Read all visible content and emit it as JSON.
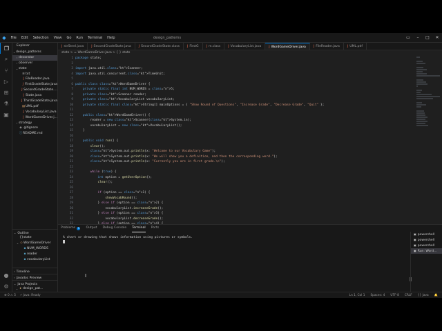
{
  "titlebar": {
    "menu": [
      "File",
      "Edit",
      "Selection",
      "View",
      "Go",
      "Run",
      "Terminal",
      "Help"
    ],
    "title": "design_patterns"
  },
  "explorer": {
    "header": "Explorer",
    "root": "design_patterns",
    "items": [
      {
        "label": "decorator",
        "kind": "folder",
        "depth": 1,
        "open": false,
        "selected": true
      },
      {
        "label": "observer",
        "kind": "folder",
        "depth": 1,
        "open": false
      },
      {
        "label": "state",
        "kind": "folder",
        "depth": 1,
        "open": true
      },
      {
        "label": "txt",
        "kind": "text",
        "depth": 2
      },
      {
        "label": "FileReader.java",
        "kind": "java",
        "depth": 2
      },
      {
        "label": "FirstGradeState.java",
        "kind": "java",
        "depth": 2
      },
      {
        "label": "SecondGradeState....",
        "kind": "java",
        "depth": 2
      },
      {
        "label": "State.java",
        "kind": "java",
        "depth": 2
      },
      {
        "label": "ThirdGradeState.java",
        "kind": "java",
        "depth": 2
      },
      {
        "label": "UML.pdf",
        "kind": "pdf",
        "depth": 2
      },
      {
        "label": "VocabularyList.java",
        "kind": "java",
        "depth": 2
      },
      {
        "label": "WordGameDriver.j...",
        "kind": "java",
        "depth": 2
      },
      {
        "label": "strategy",
        "kind": "folder",
        "depth": 1,
        "open": false
      },
      {
        "label": ".gitignore",
        "kind": "git",
        "depth": 1
      },
      {
        "label": "README.md",
        "kind": "md",
        "depth": 1
      }
    ],
    "outline_header": "Outline",
    "outline": [
      {
        "label": "state",
        "kind": "pkg",
        "depth": 1
      },
      {
        "label": "WordGameDriver",
        "kind": "class",
        "depth": 1
      },
      {
        "label": "NUM_WORDS",
        "kind": "field",
        "depth": 2
      },
      {
        "label": "reader",
        "kind": "field",
        "depth": 2
      },
      {
        "label": "vocabularyList",
        "kind": "field",
        "depth": 2
      }
    ],
    "timeline_header": "Timeline",
    "javadoc_header": "Javadoc Preview",
    "java_projects_header": "Java Projects",
    "java_projects": [
      {
        "label": "design_pat...",
        "depth": 1
      },
      {
        "label": "state",
        "depth": 2
      },
      {
        "label": "WordGa...",
        "depth": 3
      },
      {
        "label": "UML.pdf",
        "depth": 3
      },
      {
        "label": "state.txt",
        "depth": 2
      }
    ]
  },
  "tabs": [
    {
      "label": "strSteel.java",
      "active": false
    },
    {
      "label": "SecondGradeState.java",
      "active": false
    },
    {
      "label": "SecondGradeState.class",
      "active": false
    },
    {
      "label": "FirstG",
      "active": false
    },
    {
      "label": "m.class",
      "active": false
    },
    {
      "label": "VocabularyList.java",
      "active": false
    },
    {
      "label": "WordGameDriver.java",
      "active": true
    },
    {
      "label": "FileReader.java",
      "active": false
    },
    {
      "label": "UML.pdf",
      "active": false
    }
  ],
  "breadcrumb": "state > ☕ WordGameDriver.java > { } state",
  "code_lines": [
    "package state;",
    "",
    "import java.util.Scanner;",
    "import java.util.concurrent.TimeUnit;",
    "",
    "public class WordGameDriver {",
    "    private static final int NUM_WORDS = 5;",
    "    private Scanner reader;",
    "    private VocabularyList vocabularyList;",
    "    private static final String[] mainOptions = { \"Show Round of Questions\", \"Increase Grade\", \"Decrease Grade\", \"Quit\" };",
    "",
    "    public WordGameDriver() {",
    "        reader = new Scanner(System.in);",
    "        vocabularyList = new VocabularyList();",
    "    }",
    "",
    "    public void run() {",
    "        clear();",
    "        System.out.println(x: \"Welcome to our Vocabulary Game\");",
    "        System.out.println(x: \"We will show you a definition, and then the corresponding word.\");",
    "        System.out.println(x: \"Currently you are in first grade.\\n\");",
    "",
    "        while (true) {",
    "            int option = getUserOption();",
    "            clear();",
    "",
    "            if (option == 1) {",
    "                showVocabRound();",
    "            } else if (option == 2) {",
    "                vocabularyList.increaseGrade();",
    "            } else if (option == 3) {",
    "                vocabularyList.decreaseGrade();",
    "            } else if (option == 4) {",
    "                System.out.println(x: \"Goodbye\");"
  ],
  "panel": {
    "tabs": [
      {
        "label": "Problems",
        "badge": "5",
        "active": false
      },
      {
        "label": "Output",
        "active": false
      },
      {
        "label": "Debug Console",
        "active": false
      },
      {
        "label": "Terminal",
        "active": true
      },
      {
        "label": "Ports",
        "active": false
      }
    ],
    "terminal_text": "A chart or drawing that shows information using pictures or symbols.",
    "terminals": [
      {
        "label": "powershell",
        "active": false
      },
      {
        "label": "powershell",
        "active": false
      },
      {
        "label": "powershell",
        "active": false
      },
      {
        "label": "Run: Word...",
        "active": true
      }
    ]
  },
  "status": {
    "left": [
      "⊗ 0 ⚠ 5",
      "⚡ Java: Ready"
    ],
    "right": [
      "Ln 1, Col 1",
      "Spaces: 4",
      "UTF-8",
      "CRLF",
      "{} Java",
      "🔔"
    ]
  },
  "colors": {
    "accent": "#0078d4",
    "background": "#1f1f1f",
    "sidebar": "#181818"
  }
}
